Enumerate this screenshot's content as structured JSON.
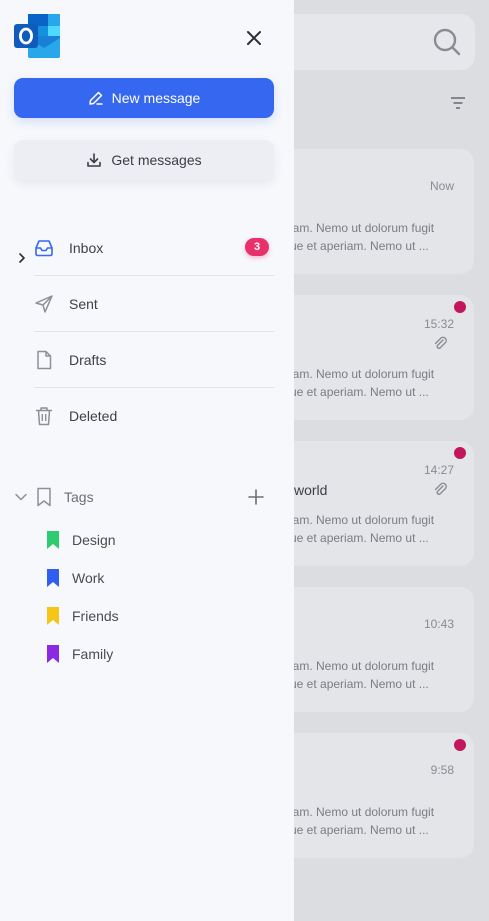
{
  "app": {
    "name": "Outlook"
  },
  "drawer": {
    "new_message_label": "New message",
    "get_messages_label": "Get messages",
    "folders": [
      {
        "label": "Inbox",
        "icon": "inbox-icon",
        "badge": "3"
      },
      {
        "label": "Sent",
        "icon": "send-icon"
      },
      {
        "label": "Drafts",
        "icon": "file-icon"
      },
      {
        "label": "Deleted",
        "icon": "trash-icon"
      }
    ],
    "tags_label": "Tags",
    "tags": [
      {
        "label": "Design",
        "color": "#2ecc71"
      },
      {
        "label": "Work",
        "color": "#2f5ff0"
      },
      {
        "label": "Friends",
        "color": "#f5c518"
      },
      {
        "label": "Family",
        "color": "#8a2be2"
      }
    ]
  },
  "mail_list": {
    "items": [
      {
        "time": "Now",
        "line1": "iam. Nemo ut dolorum fugit",
        "line2": "ue et aperiam. Nemo ut ...",
        "unread": false,
        "attachment": false,
        "subject": ""
      },
      {
        "time": "15:32",
        "line1": "iam. Nemo ut dolorum fugit",
        "line2": "ue et aperiam. Nemo ut ...",
        "unread": true,
        "attachment": true,
        "subject": ""
      },
      {
        "time": "14:27",
        "line1": "iam. Nemo ut dolorum fugit",
        "line2": "ue et aperiam. Nemo ut ...",
        "unread": true,
        "attachment": true,
        "subject": "world"
      },
      {
        "time": "10:43",
        "line1": "iam. Nemo ut dolorum fugit",
        "line2": "ue et aperiam. Nemo ut ...",
        "unread": false,
        "attachment": false,
        "subject": ""
      },
      {
        "time": "9:58",
        "line1": "iam. Nemo ut dolorum fugit",
        "line2": "ue et aperiam. Nemo ut ...",
        "unread": true,
        "attachment": false,
        "subject": ""
      }
    ]
  },
  "colors": {
    "accent": "#3667f0",
    "badge": "#e8306a",
    "unread_dot": "#c2185b"
  }
}
